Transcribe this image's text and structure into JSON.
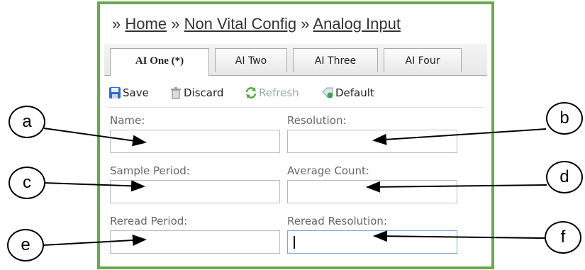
{
  "breadcrumb": {
    "items": [
      "Home",
      "Non Vital Config",
      "Analog Input"
    ],
    "separator": "»"
  },
  "tabs": [
    {
      "label": "AI One (*)",
      "active": true
    },
    {
      "label": "AI Two",
      "active": false
    },
    {
      "label": "AI Three",
      "active": false
    },
    {
      "label": "AI Four",
      "active": false
    }
  ],
  "toolbar": {
    "save_label": "Save",
    "discard_label": "Discard",
    "refresh_label": "Refresh",
    "default_label": "Default"
  },
  "form": {
    "name_label": "Name:",
    "resolution_label": "Resolution:",
    "sample_period_label": "Sample Period:",
    "average_count_label": "Average Count:",
    "reread_period_label": "Reread Period:",
    "reread_resolution_label": "Reread Resolution:",
    "name_value": "",
    "resolution_value": "",
    "sample_period_value": "",
    "average_count_value": "",
    "reread_period_value": "",
    "reread_resolution_value": ""
  },
  "callouts": [
    "a",
    "b",
    "c",
    "d",
    "e",
    "f"
  ],
  "colors": {
    "frame_border": "#6aa84f",
    "input_border": "#b8b8d0",
    "focus_border": "#7aa6d8"
  }
}
